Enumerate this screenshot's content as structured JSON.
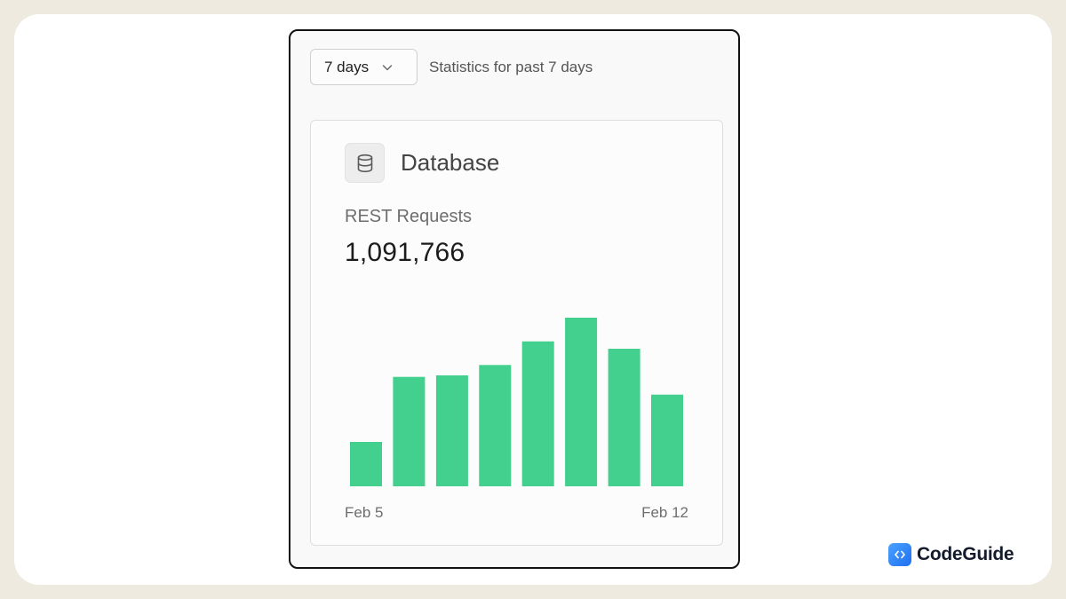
{
  "toolbar": {
    "range_select": {
      "selected": "7 days"
    },
    "stats_text": "Statistics for past 7 days"
  },
  "card": {
    "icon": "database-icon",
    "title": "Database",
    "metric_label": "REST Requests",
    "metric_value": "1,091,766"
  },
  "chart_data": {
    "type": "bar",
    "values": [
      30,
      74,
      75,
      82,
      98,
      114,
      93,
      62
    ],
    "ylim": [
      0,
      120
    ],
    "x_start_label": "Feb 5",
    "x_end_label": "Feb 12",
    "bar_color": "#43cf8e",
    "grid": false
  },
  "brand": {
    "name": "CodeGuide",
    "logo_icon": "code-brackets-icon",
    "logo_color": "#2f86f6"
  }
}
